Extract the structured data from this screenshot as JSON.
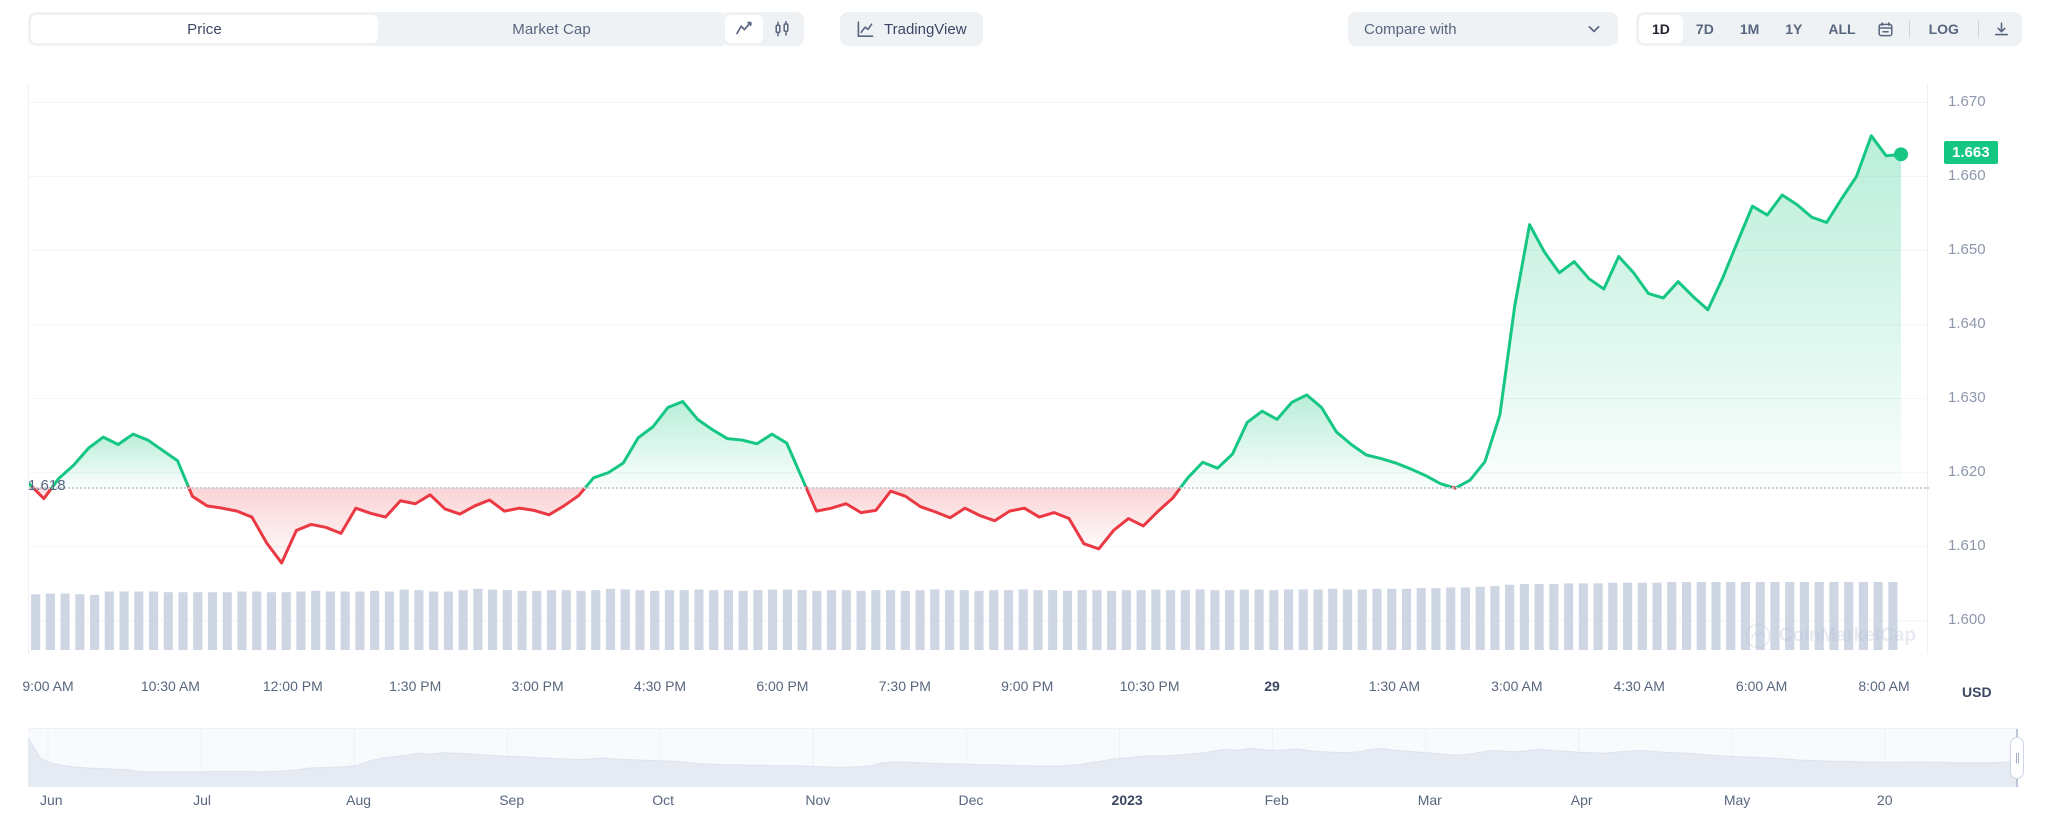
{
  "toolbar": {
    "segments": [
      {
        "label": "Price",
        "active": true
      },
      {
        "label": "Market Cap",
        "active": false
      }
    ],
    "chart_types": [
      {
        "icon": "line-chart-icon",
        "active": true
      },
      {
        "icon": "candlestick-icon",
        "active": false
      }
    ],
    "tradingview_label": "TradingView",
    "compare_label": "Compare with",
    "ranges": [
      {
        "label": "1D",
        "active": true
      },
      {
        "label": "7D",
        "active": false
      },
      {
        "label": "1M",
        "active": false
      },
      {
        "label": "1Y",
        "active": false
      },
      {
        "label": "ALL",
        "active": false
      }
    ],
    "calendar_icon": "calendar-icon",
    "log_label": "LOG",
    "download_icon": "download-icon"
  },
  "watermark": {
    "text": "CoinMarketCap"
  },
  "chart_data": {
    "type": "line",
    "title": "",
    "xlabel": "",
    "ylabel": "USD",
    "currency": "USD",
    "ylim": [
      1.5955,
      1.6725
    ],
    "y_ticks": [
      "1.670",
      "1.660",
      "1.650",
      "1.640",
      "1.630",
      "1.620",
      "1.610",
      "1.600"
    ],
    "y_tick_values": [
      1.67,
      1.66,
      1.65,
      1.64,
      1.63,
      1.62,
      1.61,
      1.6
    ],
    "current_price_label": "1.663",
    "current_price": 1.663,
    "baseline_label": "1.618",
    "baseline_value": 1.618,
    "grid": true,
    "legend": "none",
    "x_tick_labels": [
      "9:00 AM",
      "10:30 AM",
      "12:00 PM",
      "1:30 PM",
      "3:00 PM",
      "4:30 PM",
      "6:00 PM",
      "7:30 PM",
      "9:00 PM",
      "10:30 PM",
      "29",
      "1:30 AM",
      "3:00 AM",
      "4:30 AM",
      "6:00 AM",
      "8:00 AM"
    ],
    "x_tick_bold_index": 10,
    "colors": {
      "up": "#16c784",
      "down": "#ea3943",
      "volume": "#ced6e4"
    },
    "series": [
      {
        "name": "Price (USD)",
        "values": [
          1.6185,
          1.6165,
          1.6192,
          1.621,
          1.6233,
          1.6248,
          1.6238,
          1.6252,
          1.6244,
          1.623,
          1.6216,
          1.6168,
          1.6155,
          1.6152,
          1.6148,
          1.614,
          1.6105,
          1.6078,
          1.6122,
          1.613,
          1.6126,
          1.6118,
          1.6152,
          1.6145,
          1.614,
          1.6162,
          1.6158,
          1.617,
          1.6151,
          1.6144,
          1.6155,
          1.6163,
          1.6148,
          1.6152,
          1.6149,
          1.6143,
          1.6155,
          1.6169,
          1.6193,
          1.62,
          1.6213,
          1.6247,
          1.6262,
          1.6288,
          1.6296,
          1.6272,
          1.6258,
          1.6246,
          1.6244,
          1.6239,
          1.6252,
          1.624,
          1.6194,
          1.6148,
          1.6152,
          1.6158,
          1.6146,
          1.6149,
          1.6175,
          1.6168,
          1.6154,
          1.6147,
          1.6139,
          1.6152,
          1.6142,
          1.6135,
          1.6148,
          1.6152,
          1.614,
          1.6146,
          1.6138,
          1.6104,
          1.6097,
          1.6122,
          1.6138,
          1.6128,
          1.6148,
          1.6166,
          1.6193,
          1.6214,
          1.6206,
          1.6225,
          1.6268,
          1.6283,
          1.6272,
          1.6295,
          1.6305,
          1.6288,
          1.6255,
          1.6238,
          1.6224,
          1.6219,
          1.6213,
          1.6205,
          1.6196,
          1.6185,
          1.6179,
          1.619,
          1.6215,
          1.6278,
          1.6425,
          1.6535,
          1.6498,
          1.647,
          1.6485,
          1.6462,
          1.6448,
          1.6492,
          1.647,
          1.6442,
          1.6436,
          1.6458,
          1.6438,
          1.642,
          1.6463,
          1.6512,
          1.656,
          1.6548,
          1.6575,
          1.6562,
          1.6545,
          1.6538,
          1.657,
          1.66,
          1.6655,
          1.6628,
          1.663
        ]
      }
    ],
    "volume": {
      "name": "Volume",
      "values": [
        0.82,
        0.83,
        0.83,
        0.82,
        0.81,
        0.86,
        0.86,
        0.86,
        0.86,
        0.85,
        0.85,
        0.85,
        0.85,
        0.85,
        0.86,
        0.86,
        0.85,
        0.85,
        0.86,
        0.87,
        0.86,
        0.86,
        0.86,
        0.87,
        0.86,
        0.89,
        0.88,
        0.86,
        0.86,
        0.88,
        0.9,
        0.89,
        0.88,
        0.87,
        0.87,
        0.88,
        0.88,
        0.87,
        0.88,
        0.9,
        0.89,
        0.88,
        0.87,
        0.88,
        0.88,
        0.89,
        0.88,
        0.88,
        0.87,
        0.88,
        0.89,
        0.89,
        0.88,
        0.87,
        0.88,
        0.88,
        0.87,
        0.88,
        0.88,
        0.87,
        0.88,
        0.89,
        0.88,
        0.88,
        0.87,
        0.88,
        0.88,
        0.89,
        0.88,
        0.88,
        0.87,
        0.88,
        0.88,
        0.87,
        0.88,
        0.88,
        0.89,
        0.88,
        0.88,
        0.89,
        0.88,
        0.88,
        0.89,
        0.89,
        0.88,
        0.89,
        0.89,
        0.89,
        0.9,
        0.89,
        0.89,
        0.9,
        0.9,
        0.9,
        0.91,
        0.91,
        0.92,
        0.92,
        0.93,
        0.94,
        0.96,
        0.97,
        0.97,
        0.97,
        0.98,
        0.98,
        0.98,
        0.99,
        0.99,
        0.99,
        0.99,
        1.0,
        1.0,
        1.0,
        1.0,
        1.0,
        1.0,
        1.0,
        1.0,
        1.0,
        1.0,
        1.0,
        1.0,
        1.0,
        1.0,
        1.0,
        1.0
      ]
    }
  },
  "navigator": {
    "month_labels": [
      "Jun",
      "Jul",
      "Aug",
      "Sep",
      "Oct",
      "Nov",
      "Dec",
      "2023",
      "Feb",
      "Mar",
      "Apr",
      "May",
      "20"
    ],
    "bold_label_index": 7,
    "series_values": [
      0.95,
      0.52,
      0.4,
      0.36,
      0.33,
      0.31,
      0.3,
      0.29,
      0.28,
      0.24,
      0.23,
      0.23,
      0.23,
      0.23,
      0.23,
      0.24,
      0.24,
      0.24,
      0.24,
      0.23,
      0.24,
      0.25,
      0.27,
      0.31,
      0.32,
      0.33,
      0.34,
      0.37,
      0.46,
      0.52,
      0.55,
      0.58,
      0.62,
      0.6,
      0.63,
      0.62,
      0.61,
      0.59,
      0.58,
      0.56,
      0.55,
      0.54,
      0.52,
      0.51,
      0.5,
      0.49,
      0.5,
      0.52,
      0.5,
      0.49,
      0.48,
      0.47,
      0.46,
      0.45,
      0.43,
      0.4,
      0.39,
      0.38,
      0.38,
      0.37,
      0.37,
      0.36,
      0.36,
      0.36,
      0.35,
      0.34,
      0.33,
      0.33,
      0.34,
      0.36,
      0.42,
      0.44,
      0.43,
      0.42,
      0.41,
      0.4,
      0.4,
      0.39,
      0.38,
      0.38,
      0.37,
      0.36,
      0.36,
      0.35,
      0.35,
      0.36,
      0.38,
      0.42,
      0.46,
      0.5,
      0.52,
      0.55,
      0.57,
      0.56,
      0.58,
      0.6,
      0.62,
      0.66,
      0.7,
      0.68,
      0.72,
      0.7,
      0.68,
      0.69,
      0.71,
      0.67,
      0.65,
      0.64,
      0.63,
      0.65,
      0.7,
      0.72,
      0.68,
      0.66,
      0.64,
      0.62,
      0.6,
      0.58,
      0.6,
      0.64,
      0.68,
      0.66,
      0.65,
      0.68,
      0.7,
      0.67,
      0.66,
      0.64,
      0.63,
      0.62,
      0.64,
      0.66,
      0.68,
      0.66,
      0.64,
      0.63,
      0.62,
      0.6,
      0.58,
      0.56,
      0.55,
      0.54,
      0.53,
      0.52,
      0.5,
      0.48,
      0.47,
      0.46,
      0.45,
      0.45,
      0.44,
      0.44,
      0.43,
      0.43,
      0.44,
      0.44,
      0.43,
      0.43,
      0.42,
      0.42,
      0.42,
      0.42,
      0.43,
      0.48
    ]
  }
}
